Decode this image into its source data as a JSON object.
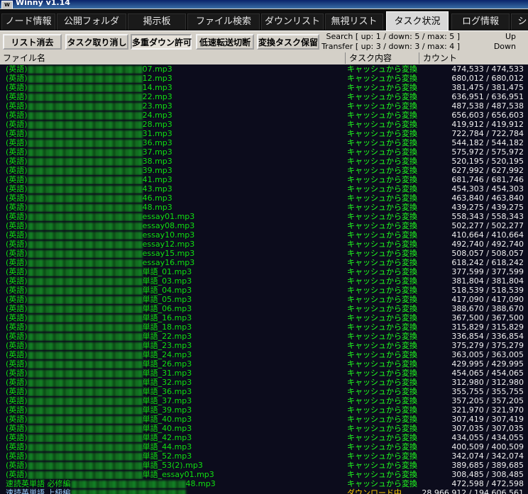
{
  "window": {
    "title": "Winny v1.14",
    "icon_label": "W"
  },
  "tabs": [
    {
      "label": "ノード情報"
    },
    {
      "label": "公開フォルダ"
    },
    {
      "label": "掲示板"
    },
    {
      "label": "ファイル検索"
    },
    {
      "label": "ダウンリスト"
    },
    {
      "label": "無視リスト"
    },
    {
      "label": "タスク状況",
      "active": true
    },
    {
      "label": "ログ情報"
    },
    {
      "label": "シ"
    }
  ],
  "toolbar": {
    "clear_list": "リスト消去",
    "cancel_task": "タスク取り消し",
    "allow_multi_download": "多重ダウン許可",
    "cut_slow_transfer": "低速転送切断",
    "keep_convert_task": "変換タスク保留"
  },
  "status": {
    "search_label": "Search",
    "search_values": "[ up: 1 / down: 5 / max: 5 ]",
    "search_state": "Up",
    "transfer_label": "Transfer",
    "transfer_values": "[ up: 3 / down: 3 / max: 4 ]",
    "transfer_state": "Down"
  },
  "columns": {
    "filename": "ファイル名",
    "task": "タスク内容",
    "count": "カウント"
  },
  "rows": [
    {
      "prefix": "(英語)",
      "name": "07.mp3",
      "status": "キャッシュから変換",
      "count": "474,533 / 474,533"
    },
    {
      "prefix": "(英語)",
      "name": "12.mp3",
      "status": "キャッシュから変換",
      "count": "680,012 / 680,012"
    },
    {
      "prefix": "(英語)",
      "name": "14.mp3",
      "status": "キャッシュから変換",
      "count": "381,475 / 381,475"
    },
    {
      "prefix": "(英語)",
      "name": "22.mp3",
      "status": "キャッシュから変換",
      "count": "636,951 / 636,951"
    },
    {
      "prefix": "(英語)",
      "name": "23.mp3",
      "status": "キャッシュから変換",
      "count": "487,538 / 487,538"
    },
    {
      "prefix": "(英語)",
      "name": "24.mp3",
      "status": "キャッシュから変換",
      "count": "656,603 / 656,603"
    },
    {
      "prefix": "(英語)",
      "name": "28.mp3",
      "status": "キャッシュから変換",
      "count": "419,912 / 419,912"
    },
    {
      "prefix": "(英語)",
      "name": "31.mp3",
      "status": "キャッシュから変換",
      "count": "722,784 / 722,784"
    },
    {
      "prefix": "(英語)",
      "name": "36.mp3",
      "status": "キャッシュから変換",
      "count": "544,182 / 544,182"
    },
    {
      "prefix": "(英語)",
      "name": "37.mp3",
      "status": "キャッシュから変換",
      "count": "575,972 / 575,972"
    },
    {
      "prefix": "(英語)",
      "name": "38.mp3",
      "status": "キャッシュから変換",
      "count": "520,195 / 520,195"
    },
    {
      "prefix": "(英語)",
      "name": "39.mp3",
      "status": "キャッシュから変換",
      "count": "627,992 / 627,992"
    },
    {
      "prefix": "(英語)",
      "name": "41.mp3",
      "status": "キャッシュから変換",
      "count": "681,746 / 681,746"
    },
    {
      "prefix": "(英語)",
      "name": "43.mp3",
      "status": "キャッシュから変換",
      "count": "454,303 / 454,303"
    },
    {
      "prefix": "(英語)",
      "name": "46.mp3",
      "status": "キャッシュから変換",
      "count": "463,840 / 463,840"
    },
    {
      "prefix": "(英語)",
      "name": "48.mp3",
      "status": "キャッシュから変換",
      "count": "439,275 / 439,275"
    },
    {
      "prefix": "(英語)",
      "name": "essay01.mp3",
      "status": "キャッシュから変換",
      "count": "558,343 / 558,343"
    },
    {
      "prefix": "(英語)",
      "name": "essay08.mp3",
      "status": "キャッシュから変換",
      "count": "502,277 / 502,277"
    },
    {
      "prefix": "(英語)",
      "name": "essay10.mp3",
      "status": "キャッシュから変換",
      "count": "410,664 / 410,664"
    },
    {
      "prefix": "(英語)",
      "name": "essay12.mp3",
      "status": "キャッシュから変換",
      "count": "492,740 / 492,740"
    },
    {
      "prefix": "(英語)",
      "name": "essay15.mp3",
      "status": "キャッシュから変換",
      "count": "508,057 / 508,057"
    },
    {
      "prefix": "(英語)",
      "name": "essay16.mp3",
      "status": "キャッシュから変換",
      "count": "618,242 / 618,242"
    },
    {
      "prefix": "(英語)",
      "name": "単語_01.mp3",
      "status": "キャッシュから変換",
      "count": "377,599 / 377,599"
    },
    {
      "prefix": "(英語)",
      "name": "単語_03.mp3",
      "status": "キャッシュから変換",
      "count": "381,804 / 381,804"
    },
    {
      "prefix": "(英語)",
      "name": "単語_04.mp3",
      "status": "キャッシュから変換",
      "count": "518,539 / 518,539"
    },
    {
      "prefix": "(英語)",
      "name": "単語_05.mp3",
      "status": "キャッシュから変換",
      "count": "417,090 / 417,090"
    },
    {
      "prefix": "(英語)",
      "name": "単語_06.mp3",
      "status": "キャッシュから変換",
      "count": "388,670 / 388,670"
    },
    {
      "prefix": "(英語)",
      "name": "単語_16.mp3",
      "status": "キャッシュから変換",
      "count": "367,500 / 367,500"
    },
    {
      "prefix": "(英語)",
      "name": "単語_18.mp3",
      "status": "キャッシュから変換",
      "count": "315,829 / 315,829"
    },
    {
      "prefix": "(英語)",
      "name": "単語_22.mp3",
      "status": "キャッシュから変換",
      "count": "336,854 / 336,854"
    },
    {
      "prefix": "(英語)",
      "name": "単語_23.mp3",
      "status": "キャッシュから変換",
      "count": "375,279 / 375,279"
    },
    {
      "prefix": "(英語)",
      "name": "単語_24.mp3",
      "status": "キャッシュから変換",
      "count": "363,005 / 363,005"
    },
    {
      "prefix": "(英語)",
      "name": "単語_26.mp3",
      "status": "キャッシュから変換",
      "count": "429,995 / 429,995"
    },
    {
      "prefix": "(英語)",
      "name": "単語_31.mp3",
      "status": "キャッシュから変換",
      "count": "454,065 / 454,065"
    },
    {
      "prefix": "(英語)",
      "name": "単語_32.mp3",
      "status": "キャッシュから変換",
      "count": "312,980 / 312,980"
    },
    {
      "prefix": "(英語)",
      "name": "単語_36.mp3",
      "status": "キャッシュから変換",
      "count": "355,755 / 355,755"
    },
    {
      "prefix": "(英語)",
      "name": "単語_37.mp3",
      "status": "キャッシュから変換",
      "count": "357,205 / 357,205"
    },
    {
      "prefix": "(英語)",
      "name": "単語_39.mp3",
      "status": "キャッシュから変換",
      "count": "321,970 / 321,970"
    },
    {
      "prefix": "(英語)",
      "name": "単語_40.mp3",
      "status": "キャッシュから変換",
      "count": "307,419 / 307,419"
    },
    {
      "prefix": "(英語)",
      "name": "単語_40.mp3",
      "status": "キャッシュから変換",
      "count": "307,035 / 307,035"
    },
    {
      "prefix": "(英語)",
      "name": "単語_42.mp3",
      "status": "キャッシュから変換",
      "count": "434,055 / 434,055"
    },
    {
      "prefix": "(英語)",
      "name": "単語_44.mp3",
      "status": "キャッシュから変換",
      "count": "400,509 / 400,509"
    },
    {
      "prefix": "(英語)",
      "name": "単語_52.mp3",
      "status": "キャッシュから変換",
      "count": "342,074 / 342,074"
    },
    {
      "prefix": "(英語)",
      "name": "単語_53(2).mp3",
      "status": "キャッシュから変換",
      "count": "389,685 / 389,685"
    },
    {
      "prefix": "(英語)",
      "name": "単語_essay01.mp3",
      "status": "キャッシュから変換",
      "count": "308,485 / 308,485"
    },
    {
      "prefix": "速読英単語 必修編",
      "name": "48.mp3",
      "status": "キャッシュから変換",
      "count": "472,598 / 472,598"
    },
    {
      "prefix": "速読英単語 上級編",
      "name": "",
      "status": "ダウンロード中",
      "count": "28,966,912 / 194,606,561",
      "last": true
    }
  ]
}
